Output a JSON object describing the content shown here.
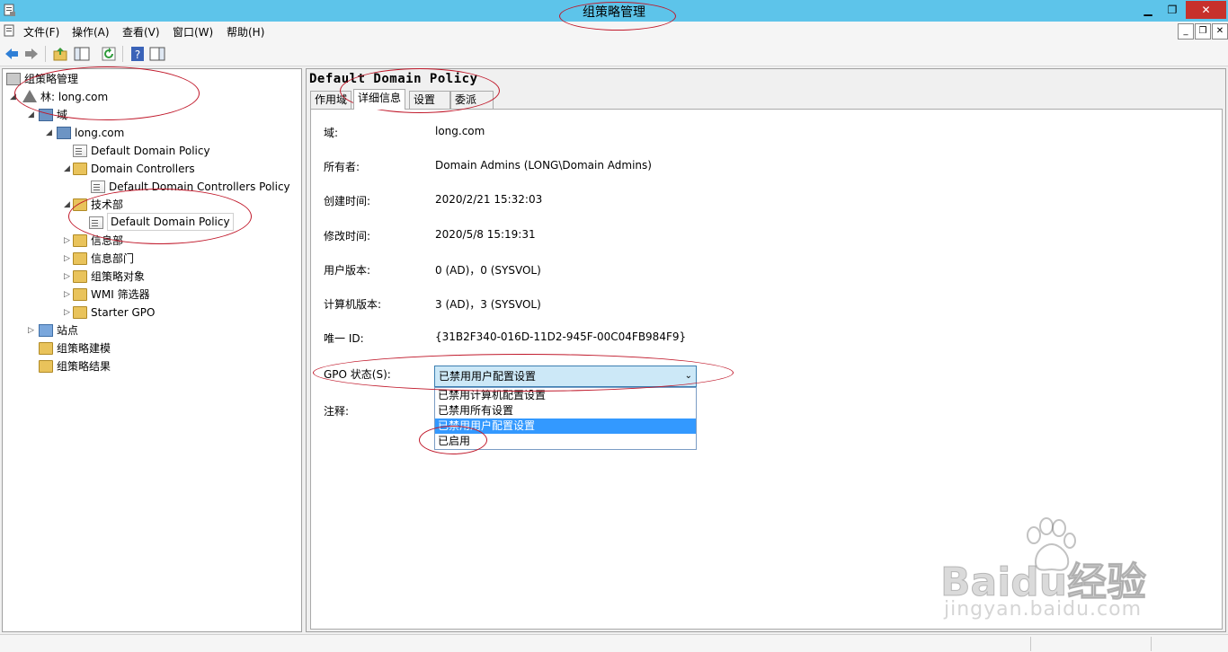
{
  "window": {
    "title": "组策略管理",
    "minimize_glyph": "▁",
    "restore_glyph": "❐",
    "close_glyph": "✕"
  },
  "menu": {
    "items": [
      "文件(F)",
      "操作(A)",
      "查看(V)",
      "窗口(W)",
      "帮助(H)"
    ],
    "mdi_minimize": "_",
    "mdi_restore": "❐",
    "mdi_close": "✕"
  },
  "toolbar": {
    "buttons": [
      "back-arrow-icon",
      "forward-arrow-icon",
      "up-folder-icon",
      "show-hide-tree-icon",
      "refresh-icon",
      "help-icon",
      "show-action-pane-icon"
    ]
  },
  "tree": {
    "root": "组策略管理",
    "forest": "林: long.com",
    "domains": "域",
    "domain": "long.com",
    "default_domain_policy": "Default Domain Policy",
    "domain_controllers": "Domain Controllers",
    "default_dc_policy": "Default Domain Controllers Policy",
    "tech_dept": "技术部",
    "tech_dept_policy": "Default Domain Policy",
    "info_dept": "信息部",
    "info_department": "信息部门",
    "gpo_objects": "组策略对象",
    "wmi_filters": "WMI 筛选器",
    "starter_gpo": "Starter GPO",
    "sites": "站点",
    "modeling": "组策略建模",
    "results": "组策略结果"
  },
  "detail": {
    "title": "Default Domain Policy",
    "tabs": [
      "作用域",
      "详细信息",
      "设置",
      "委派"
    ],
    "active_tab": "详细信息",
    "fields": {
      "domain_label": "域:",
      "domain_value": "long.com",
      "owner_label": "所有者:",
      "owner_value": "Domain Admins (LONG\\Domain Admins)",
      "created_label": "创建时间:",
      "created_value": "2020/2/21 15:32:03",
      "modified_label": "修改时间:",
      "modified_value": "2020/5/8 15:19:31",
      "user_version_label": "用户版本:",
      "user_version_value": "0 (AD)，0 (SYSVOL)",
      "computer_version_label": "计算机版本:",
      "computer_version_value": "3 (AD)，3 (SYSVOL)",
      "unique_id_label": "唯一 ID:",
      "unique_id_value": "{31B2F340-016D-11D2-945F-00C04FB984F9}",
      "gpo_status_label": "GPO 状态(S):",
      "comment_label": "注释:"
    },
    "gpo_status": {
      "selected": "已禁用用户配置设置",
      "chevron": "⌄",
      "options": [
        "已禁用计算机配置设置",
        "已禁用所有设置",
        "已禁用用户配置设置",
        "已启用"
      ],
      "highlighted_index": 2
    }
  },
  "watermark": {
    "text": "Baidu经验",
    "url": "jingyan.baidu.com"
  },
  "colors": {
    "titlebar": "#5dc4ea",
    "close_button": "#c7312b",
    "selection": "#3399ff",
    "annotation": "#c0182a"
  }
}
